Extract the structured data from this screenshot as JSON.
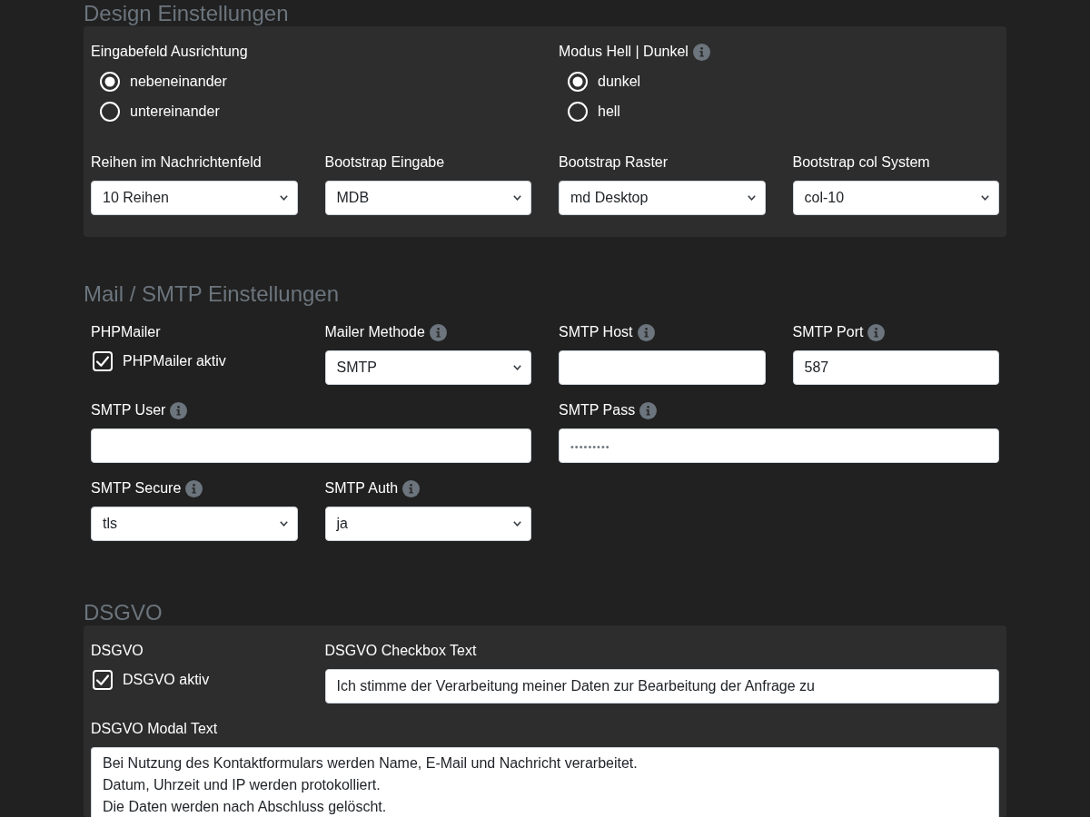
{
  "sections": [
    {
      "title": "Design Einstellungen",
      "fields": [
        {
          "kind": "radio",
          "label": "Eingabefeld Ausrichtung",
          "info": false,
          "options": [
            {
              "label": "nebeneinander",
              "selected": true
            },
            {
              "label": "untereinander",
              "selected": false
            }
          ]
        },
        {
          "kind": "radio",
          "label": "Modus Hell | Dunkel",
          "info": true,
          "options": [
            {
              "label": "dunkel",
              "selected": true
            },
            {
              "label": "hell",
              "selected": false
            }
          ]
        },
        {
          "kind": "select",
          "label": "Reihen im Nachrichtenfeld",
          "info": false,
          "value": "10 Reihen"
        },
        {
          "kind": "select",
          "label": "Bootstrap Eingabe",
          "info": false,
          "value": "MDB"
        },
        {
          "kind": "select",
          "label": "Bootstrap Raster",
          "info": false,
          "value": "md Desktop"
        },
        {
          "kind": "select",
          "label": "Bootstrap col System",
          "info": false,
          "value": "col-10"
        }
      ]
    },
    {
      "title": "Mail / SMTP Einstellungen",
      "fields": [
        {
          "kind": "checkbox",
          "label": "PHPMailer",
          "info": false,
          "option": {
            "label": "PHPMailer aktiv",
            "checked": true
          }
        },
        {
          "kind": "select",
          "label": "Mailer Methode",
          "info": true,
          "value": "SMTP"
        },
        {
          "kind": "text",
          "label": "SMTP Host",
          "info": true
        },
        {
          "kind": "text",
          "label": "SMTP Port",
          "info": true,
          "value": "587"
        },
        {
          "kind": "text",
          "label": "SMTP User",
          "info": true
        },
        {
          "kind": "password",
          "label": "SMTP Pass",
          "info": true,
          "placeholder": "•••••••••"
        },
        {
          "kind": "select",
          "label": "SMTP Secure",
          "info": true,
          "value": "tls"
        },
        {
          "kind": "select",
          "label": "SMTP Auth",
          "info": true,
          "value": "ja"
        }
      ]
    },
    {
      "title": "DSGVO",
      "fields": [
        {
          "kind": "checkbox",
          "label": "DSGVO",
          "info": false,
          "option": {
            "label": "DSGVO aktiv",
            "checked": true
          }
        },
        {
          "kind": "text",
          "label": "DSGVO Checkbox Text",
          "info": false,
          "value": "Ich stimme der Verarbeitung meiner Daten zur Bearbeitung der Anfrage zu"
        },
        {
          "kind": "textarea",
          "label": "DSGVO Modal Text",
          "info": false,
          "value": "Bei Nutzung des Kontaktformulars werden Name, E-Mail und Nachricht verarbeitet.\nDatum, Uhrzeit und IP werden protokolliert.\nDie Daten werden nach Abschluss gelöscht."
        }
      ]
    }
  ]
}
